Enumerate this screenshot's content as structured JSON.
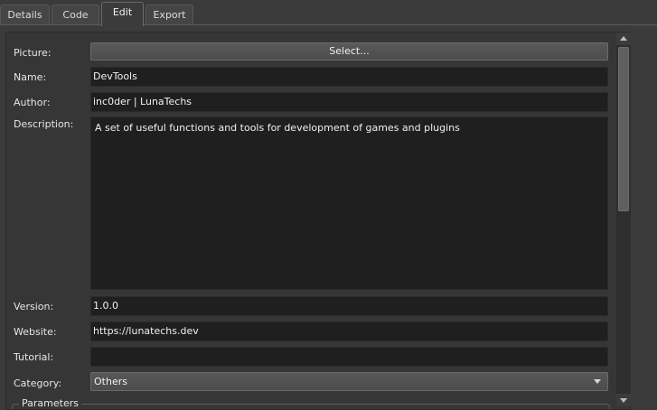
{
  "tabs": [
    "Details",
    "Code",
    "Edit",
    "Export"
  ],
  "active_tab": "Edit",
  "form": {
    "picture": {
      "label": "Picture:",
      "button": "Select..."
    },
    "name": {
      "label": "Name:",
      "value": "DevTools"
    },
    "author": {
      "label": "Author:",
      "value": "inc0der | LunaTechs"
    },
    "description": {
      "label": "Description:",
      "value": "A set of useful functions and tools for development of games and plugins"
    },
    "version": {
      "label": "Version:",
      "value": "1.0.0"
    },
    "website": {
      "label": "Website:",
      "value": "https://lunatechs.dev"
    },
    "tutorial": {
      "label": "Tutorial:",
      "value": ""
    },
    "category": {
      "label": "Category:",
      "value": "Others"
    },
    "parameters": {
      "title": "Parameters"
    }
  },
  "colors": {
    "background": "#3b3b3b",
    "panel": "#363636",
    "field": "#1f1f1f",
    "text": "#e6e6e6"
  },
  "icons": [
    "chevron-down-icon",
    "scroll-up-arrow-icon",
    "scroll-down-arrow-icon"
  ]
}
